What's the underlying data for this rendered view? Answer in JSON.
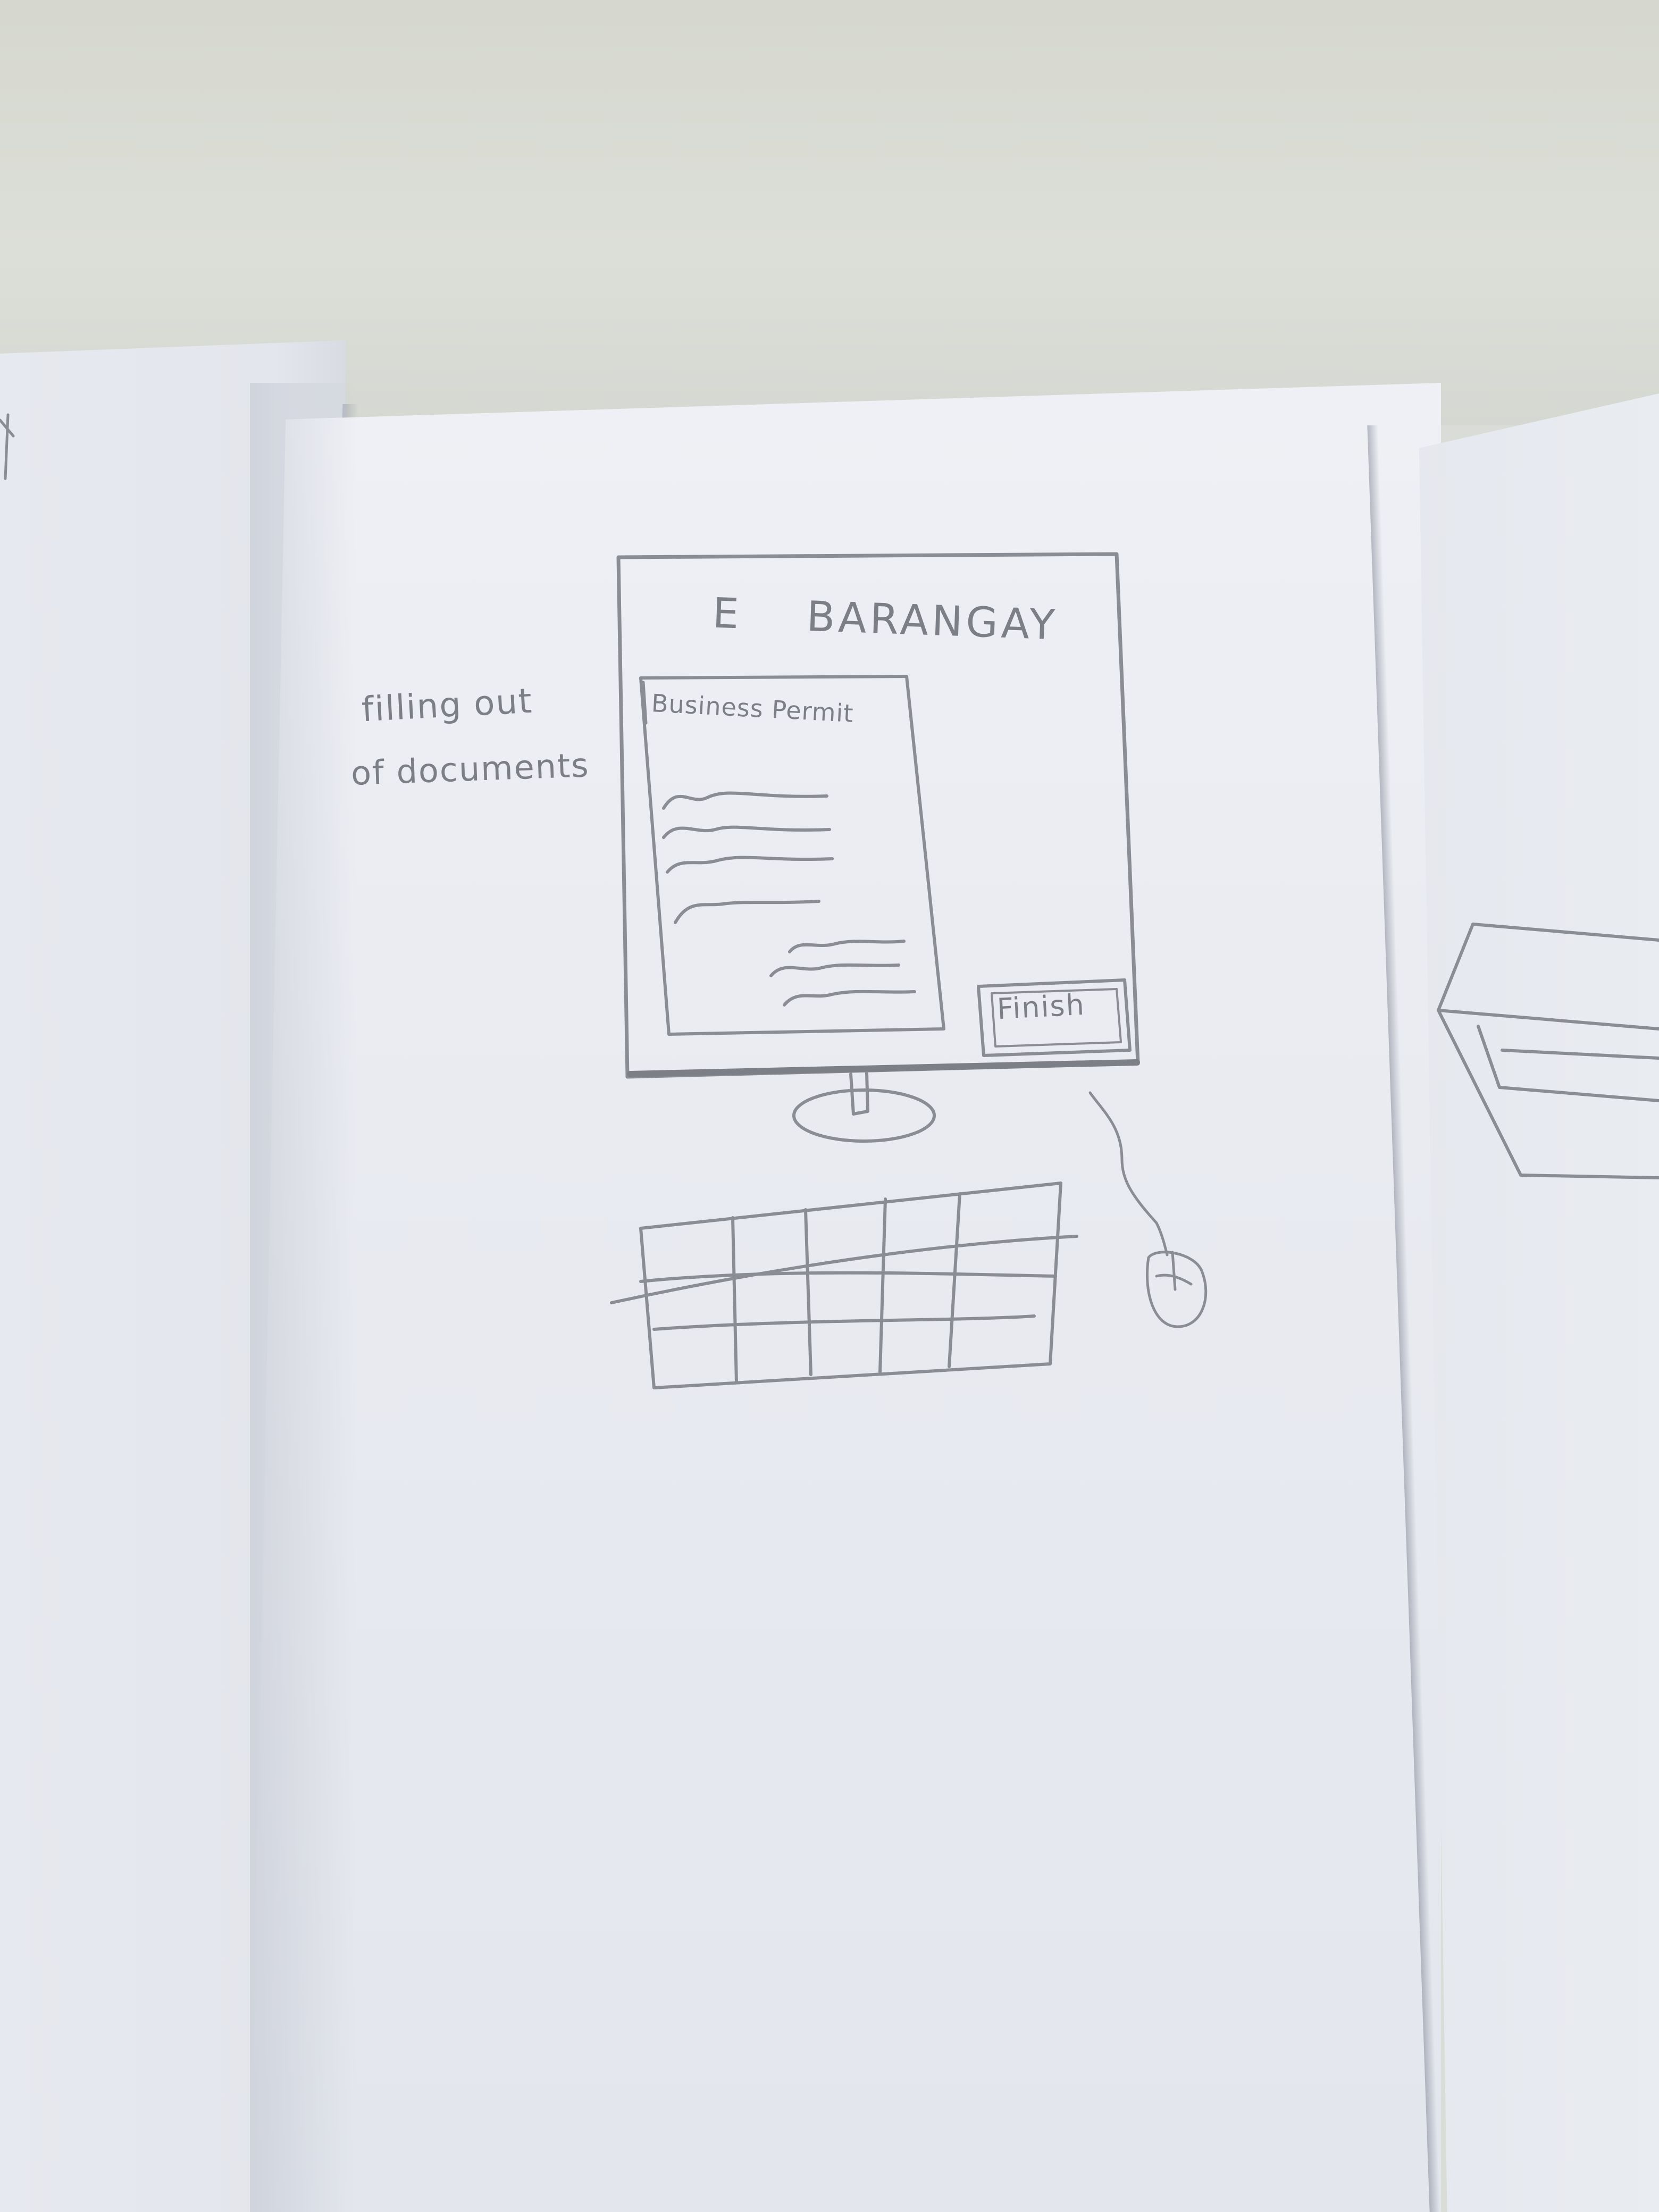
{
  "annotation": {
    "line1": "filling out",
    "line2": "of documents"
  },
  "screen": {
    "brand_icon": "E",
    "brand_title": "BARANGAY",
    "document": {
      "title": "Business Permit"
    },
    "finish_label": "Finish"
  },
  "colors": {
    "pencil": "#7d7f86",
    "paper": "#eceef3",
    "table": "#d8dbd4"
  },
  "icons": [
    "monitor-icon",
    "keyboard-icon",
    "mouse-icon"
  ]
}
